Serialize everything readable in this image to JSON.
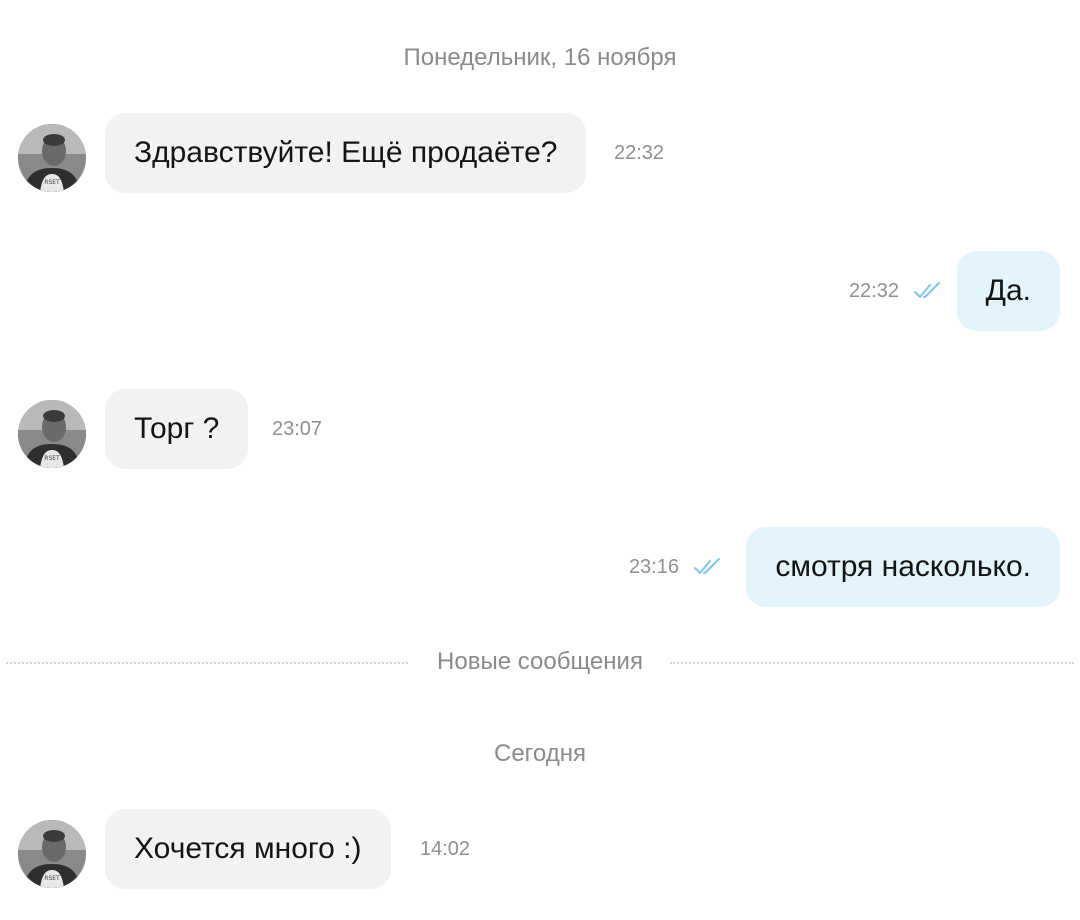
{
  "date_separators": {
    "first": "Понедельник, 16 ноября",
    "today": "Сегодня"
  },
  "new_messages_divider": "Новые сообщения",
  "messages": [
    {
      "direction": "incoming",
      "text": "Здравствуйте! Ещё продаёте?",
      "time": "22:32"
    },
    {
      "direction": "outgoing",
      "text": "Да.",
      "time": "22:32",
      "status": "read"
    },
    {
      "direction": "incoming",
      "text": "Торг ?",
      "time": "23:07"
    },
    {
      "direction": "outgoing",
      "text": "смотря насколько.",
      "time": "23:16",
      "status": "read"
    },
    {
      "direction": "incoming",
      "text": "Хочется много :)",
      "time": "14:02"
    }
  ],
  "icons": {
    "avatar": "user-avatar",
    "read_status": "double-check-icon"
  },
  "colors": {
    "incoming_bubble": "#f2f2f2",
    "outgoing_bubble": "#e3f4fc",
    "read_check": "#7cc8e8",
    "meta_text": "#8f8f8f"
  }
}
